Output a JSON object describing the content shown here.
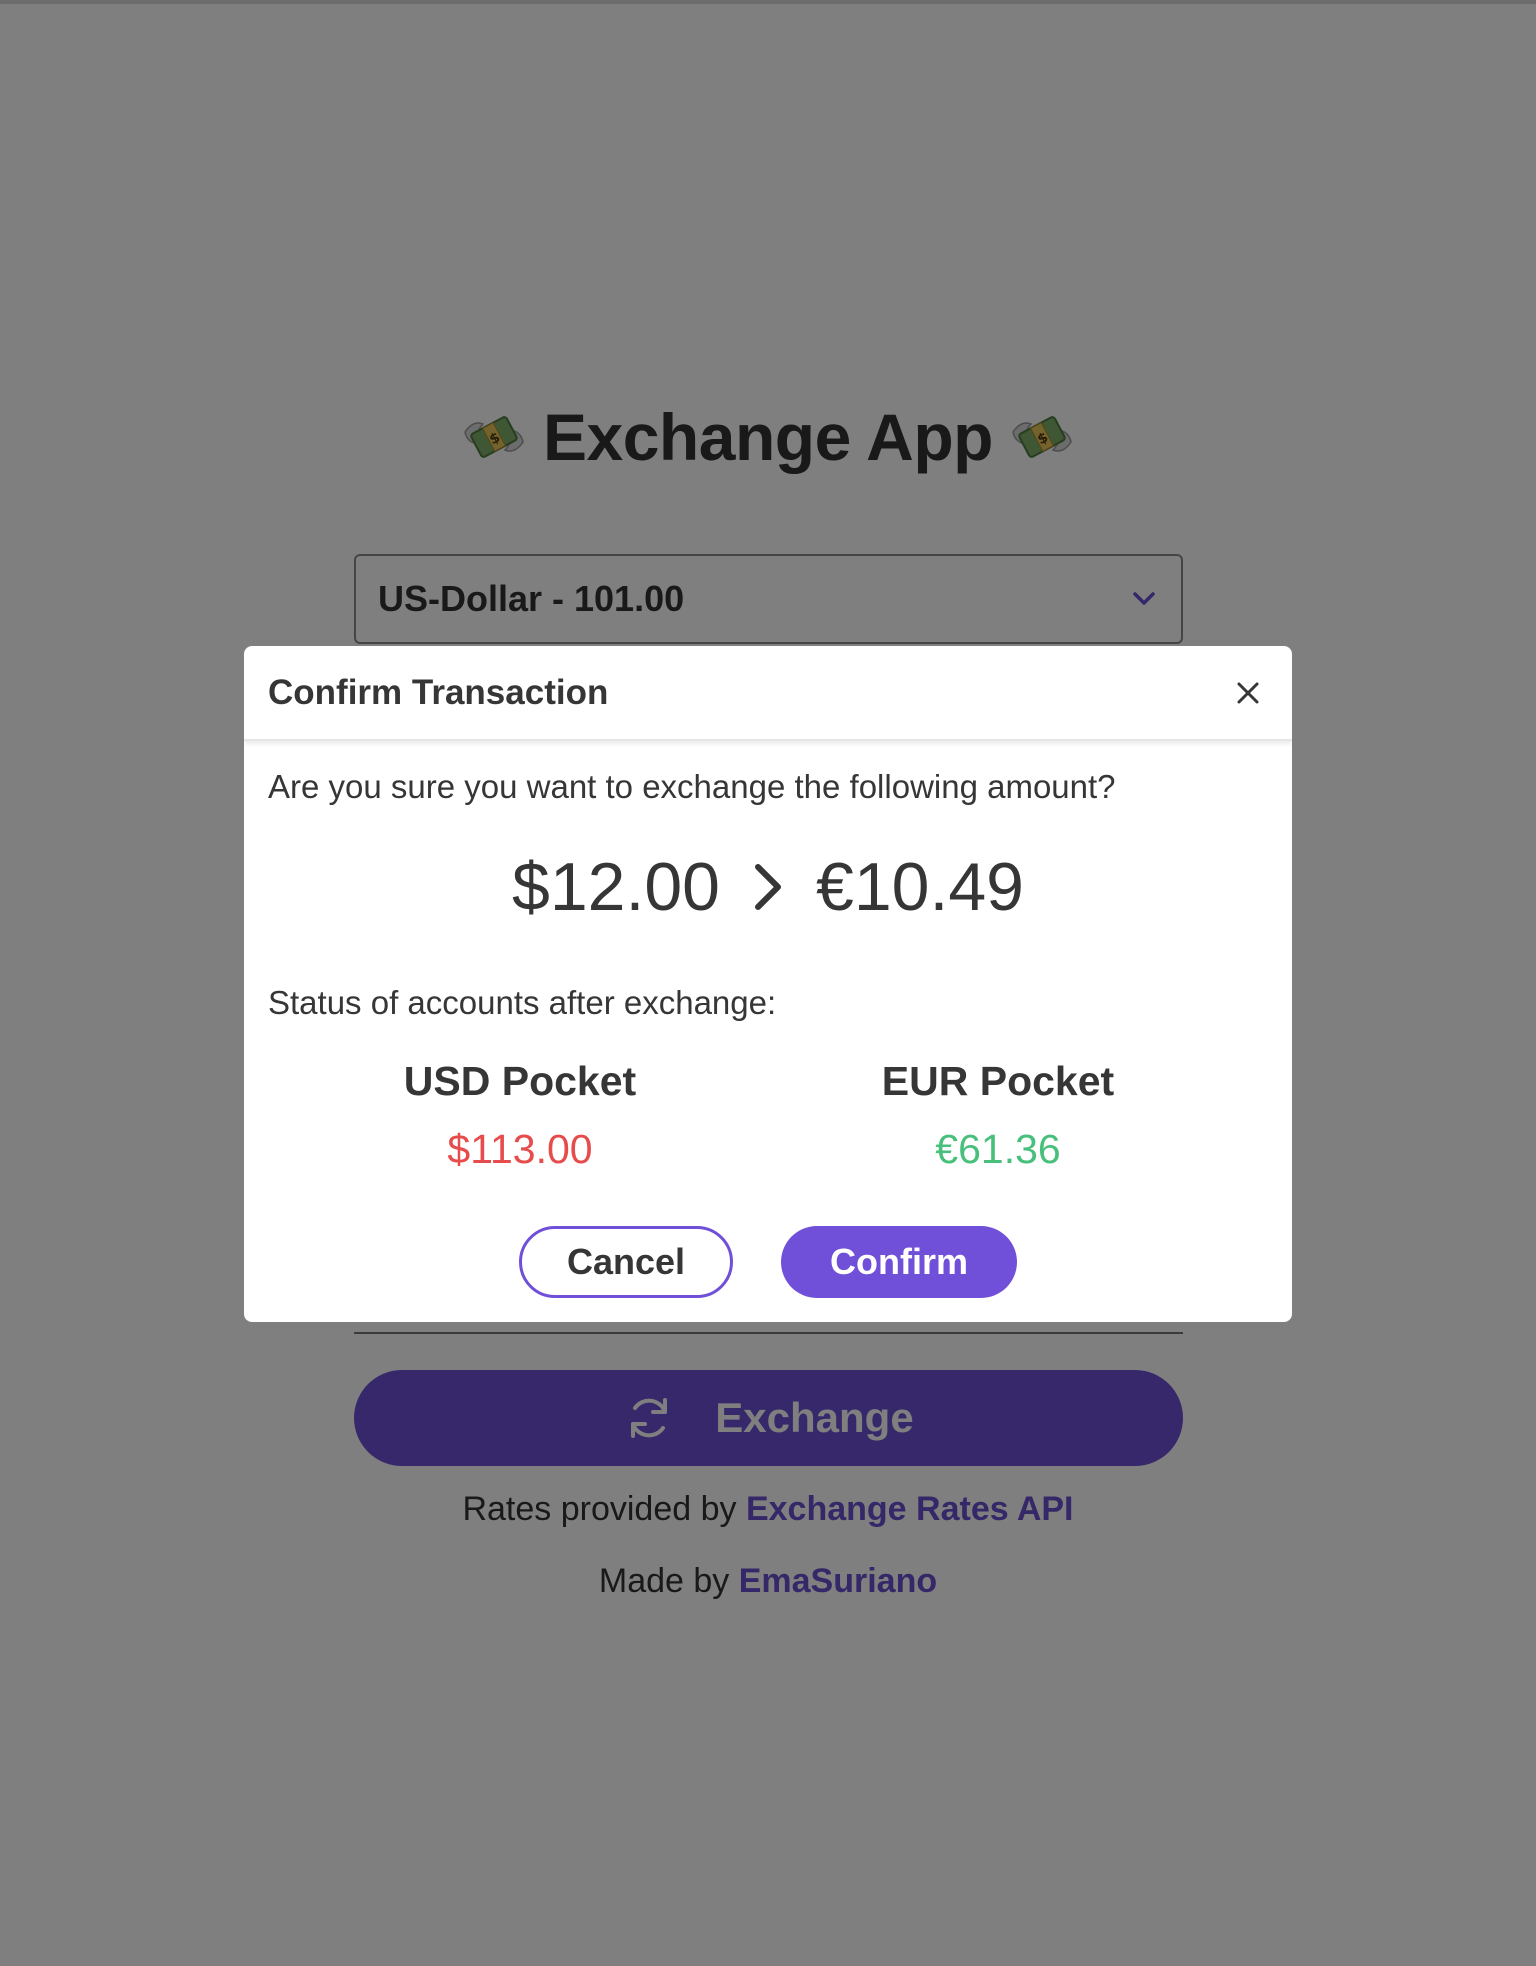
{
  "app": {
    "title": "Exchange App",
    "title_icon": "money-with-wings-icon"
  },
  "source_select": {
    "value": "US-Dollar - 101.00"
  },
  "exchange_button": {
    "label": "Exchange",
    "icon": "refresh-icon"
  },
  "footer": {
    "rates_prefix": "Rates provided by",
    "rates_link": "Exchange Rates API",
    "made_prefix": "Made by",
    "made_link": "EmaSuriano"
  },
  "modal": {
    "title": "Confirm Transaction",
    "question": "Are you sure you want to exchange the following amount?",
    "from_amount": "$12.00",
    "to_amount": "€10.49",
    "status_label": "Status of accounts after exchange:",
    "pockets": [
      {
        "name": "USD Pocket",
        "value": "$113.00",
        "color": "#e74c4c"
      },
      {
        "name": "EUR Pocket",
        "value": "€61.36",
        "color": "#48c07c"
      }
    ],
    "cancel_label": "Cancel",
    "confirm_label": "Confirm"
  },
  "colors": {
    "accent": "#7050d8",
    "overlay": "rgba(0,0,0,0.5)",
    "negative": "#e74c4c",
    "positive": "#48c07c"
  }
}
